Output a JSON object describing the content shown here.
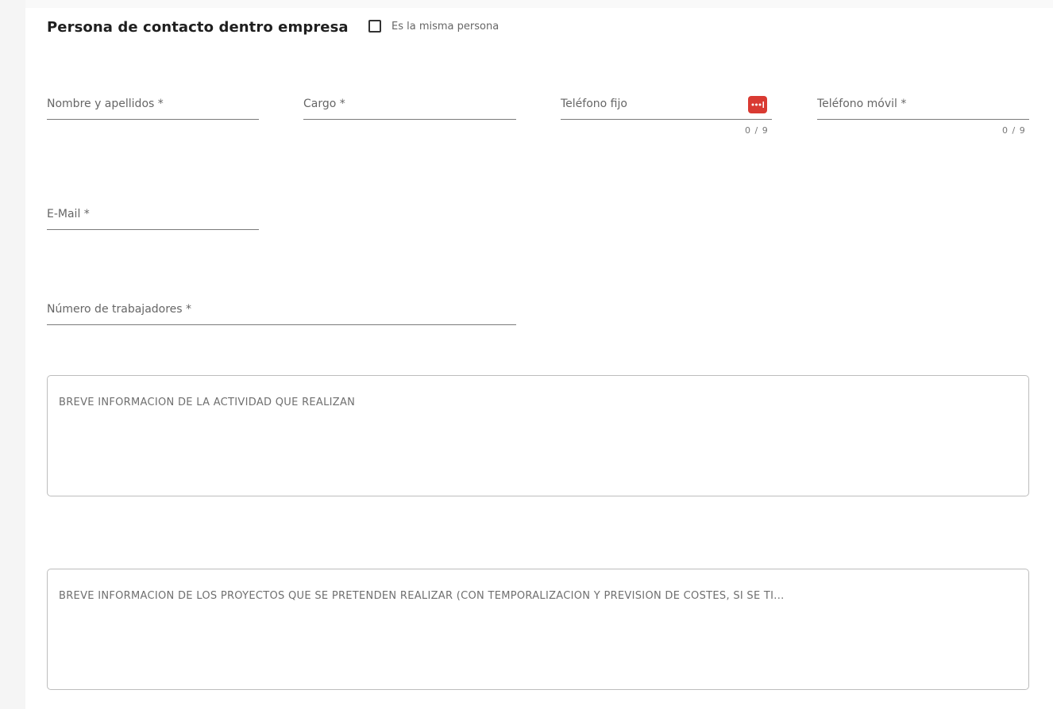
{
  "section": {
    "title": "Persona de contacto dentro empresa",
    "same_person_label": "Es la misma persona"
  },
  "fields": {
    "nombre": {
      "label": "Nombre y apellidos *"
    },
    "cargo": {
      "label": "Cargo *"
    },
    "telefono_fijo": {
      "label": "Teléfono fijo",
      "counter": "0 / 9"
    },
    "telefono_movil": {
      "label": "Teléfono móvil *",
      "counter": "0 / 9"
    },
    "email": {
      "label": "E-Mail *"
    },
    "trabajadores": {
      "label": "Número de trabajadores *"
    }
  },
  "textareas": {
    "actividad": {
      "placeholder": "BREVE INFORMACIÓN DE LA ACTIVIDAD QUE REALIZAN"
    },
    "proyectos": {
      "placeholder": "BREVE INFORMACIÓN DE LOS PROYECTOS QUE SE PRETENDEN REALIZAR (CON TEMPORALIZACIÓN Y PREVISIÓN DE COSTES, SI SE TI..."
    }
  },
  "icons": {
    "password_manager": "password-dots-icon"
  },
  "colors": {
    "password_icon_bg": "#d93a32",
    "underline": "#7a7a7a",
    "label": "#666666"
  }
}
